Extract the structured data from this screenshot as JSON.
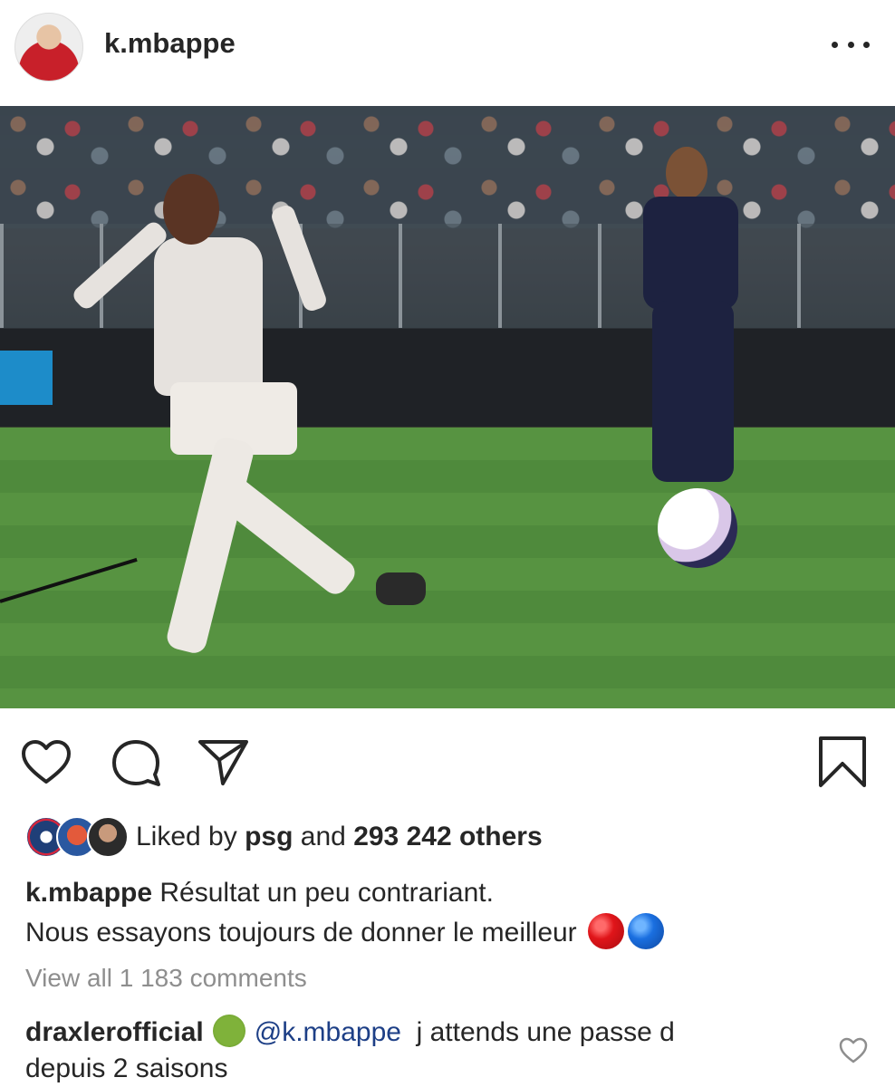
{
  "header": {
    "username": "k.mbappe",
    "avatar_icon": "profile-avatar",
    "more_icon": "more-horizontal-icon"
  },
  "post": {
    "image_icon": "soccer-photo"
  },
  "actions": {
    "like_icon": "heart-icon",
    "comment_icon": "comment-bubble-icon",
    "share_icon": "paper-plane-icon",
    "save_icon": "bookmark-icon"
  },
  "likes": {
    "prefix": "Liked by",
    "user": "psg",
    "connector": "and",
    "count": "293 242 others"
  },
  "caption": {
    "author": "k.mbappe",
    "line1": "Résultat un peu contrariant.",
    "line2": "Nous essayons toujours de donner le meilleur",
    "emoji_colors": [
      "#e0151a",
      "#1a6fe0"
    ]
  },
  "view_comments": "View all 1 183 comments",
  "comment": {
    "author": "draxlerofficial",
    "emoji": "nauseated-face",
    "mention": "@k.mbappe",
    "text_line1": "j attends une passe d",
    "text_line2": "depuis 2 saisons"
  }
}
